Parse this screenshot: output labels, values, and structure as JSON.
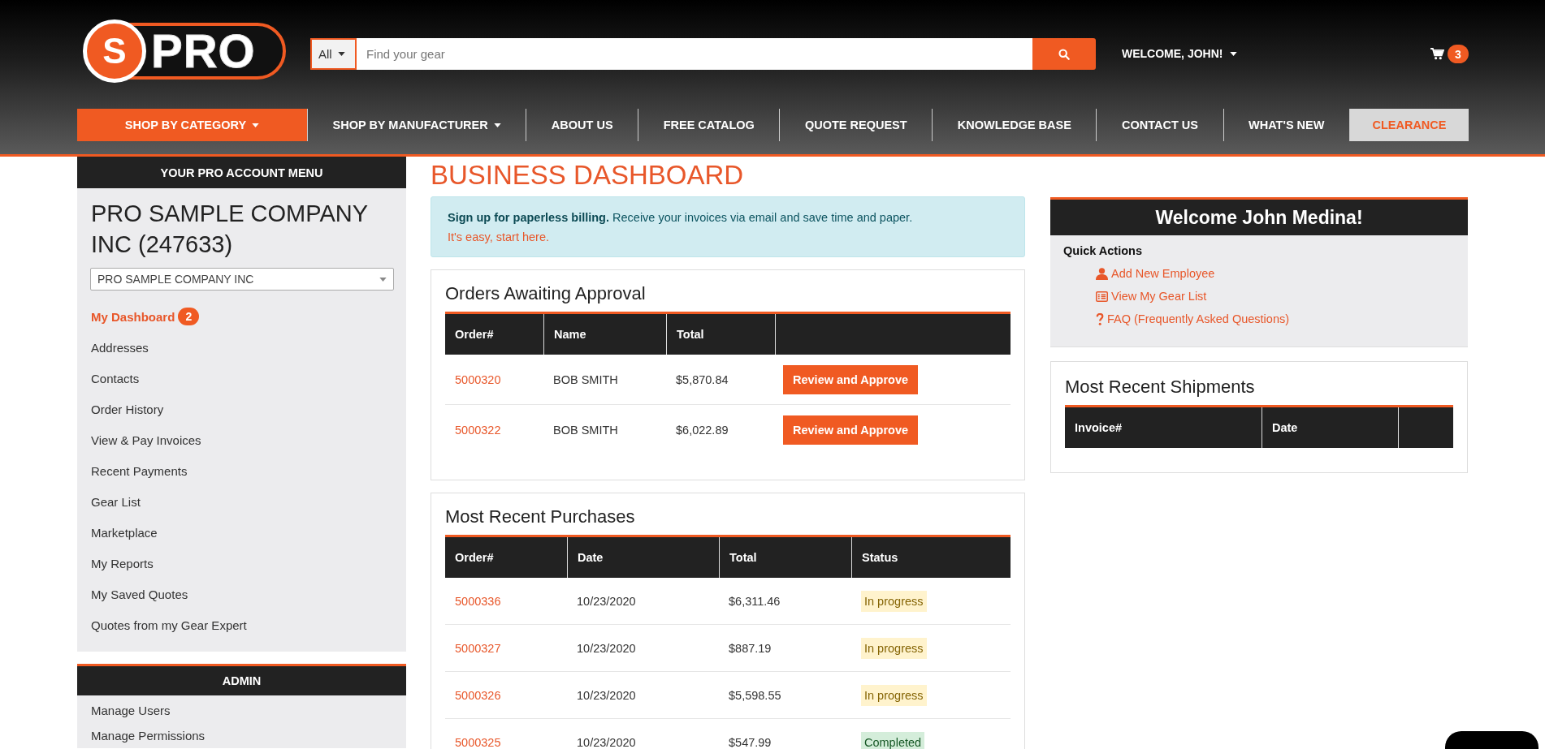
{
  "header": {
    "logo": {
      "mark": "S",
      "text": "PRO"
    },
    "search": {
      "scope": "All",
      "placeholder": "Find your gear"
    },
    "welcome": "WELCOME, JOHN!",
    "cart_count": "3"
  },
  "nav": [
    {
      "label": "SHOP BY CATEGORY",
      "kind": "highlight",
      "dropdown": true
    },
    {
      "label": "SHOP BY MANUFACTURER",
      "kind": "plain",
      "dropdown": true
    },
    {
      "label": "ABOUT US",
      "kind": "plain",
      "dropdown": false
    },
    {
      "label": "FREE CATALOG",
      "kind": "plain",
      "dropdown": false
    },
    {
      "label": "QUOTE REQUEST",
      "kind": "plain",
      "dropdown": false
    },
    {
      "label": "KNOWLEDGE BASE",
      "kind": "plain",
      "dropdown": false
    },
    {
      "label": "CONTACT US",
      "kind": "plain",
      "dropdown": false
    },
    {
      "label": "WHAT'S NEW",
      "kind": "plain",
      "dropdown": false
    },
    {
      "label": "CLEARANCE",
      "kind": "clearance",
      "dropdown": false
    }
  ],
  "sidebar": {
    "title": "YOUR PRO ACCOUNT MENU",
    "company": "PRO SAMPLE COMPANY INC (247633)",
    "account_select": "PRO SAMPLE COMPANY INC",
    "items": [
      {
        "label": "My Dashboard",
        "selected": true,
        "badge": "2"
      },
      {
        "label": "Addresses",
        "selected": false
      },
      {
        "label": "Contacts",
        "selected": false
      },
      {
        "label": "Order History",
        "selected": false
      },
      {
        "label": "View & Pay Invoices",
        "selected": false
      },
      {
        "label": "Recent Payments",
        "selected": false
      },
      {
        "label": "Gear List",
        "selected": false
      },
      {
        "label": "Marketplace",
        "selected": false
      },
      {
        "label": "My Reports",
        "selected": false
      },
      {
        "label": "My Saved Quotes",
        "selected": false
      },
      {
        "label": "Quotes from my Gear Expert",
        "selected": false
      }
    ]
  },
  "admin": {
    "title": "ADMIN",
    "items": [
      {
        "label": "Manage Users",
        "selected": false
      },
      {
        "label": "Manage Permissions",
        "selected": false
      }
    ]
  },
  "page_title": "BUSINESS DASHBOARD",
  "alert": {
    "text": "**Sign up for paperless billing.** Receive your invoices via email and save time and paper. ",
    "link": "It's easy, start here."
  },
  "approvals": {
    "title": "Orders Awaiting Approval",
    "columns": [
      "Order#",
      "Name",
      "Total"
    ],
    "rows": [
      {
        "order": "5000320",
        "name": "BOB SMITH",
        "total": "$5,870.84",
        "action": "Review and Approve"
      },
      {
        "order": "5000322",
        "name": "BOB SMITH",
        "total": "$6,022.89",
        "action": "Review and Approve"
      }
    ]
  },
  "purchases": {
    "title": "Most Recent Purchases",
    "columns": [
      "Order#",
      "Date",
      "Total",
      "Status"
    ],
    "rows": [
      {
        "order": "5000336",
        "date": "10/23/2020",
        "total": "$6,311.46",
        "status": {
          "label": "In progress",
          "kind": "in_progress"
        }
      },
      {
        "order": "5000327",
        "date": "10/23/2020",
        "total": "$887.19",
        "status": {
          "label": "In progress",
          "kind": "in_progress"
        }
      },
      {
        "order": "5000326",
        "date": "10/23/2020",
        "total": "$5,598.55",
        "status": {
          "label": "In progress",
          "kind": "in_progress"
        }
      },
      {
        "order": "5000325",
        "date": "10/23/2020",
        "total": "$547.99",
        "status": {
          "label": "Completed",
          "kind": "completed"
        }
      }
    ]
  },
  "welcome_card": {
    "title": "Welcome John Medina!",
    "subtitle": "Quick Actions",
    "actions": [
      {
        "label": "Add New Employee"
      },
      {
        "label": "View My Gear List"
      },
      {
        "label": "FAQ (Frequently Asked Questions)"
      }
    ]
  },
  "shipments": {
    "title": "Most Recent Shipments",
    "columns": [
      "Invoice#",
      "Date"
    ]
  }
}
